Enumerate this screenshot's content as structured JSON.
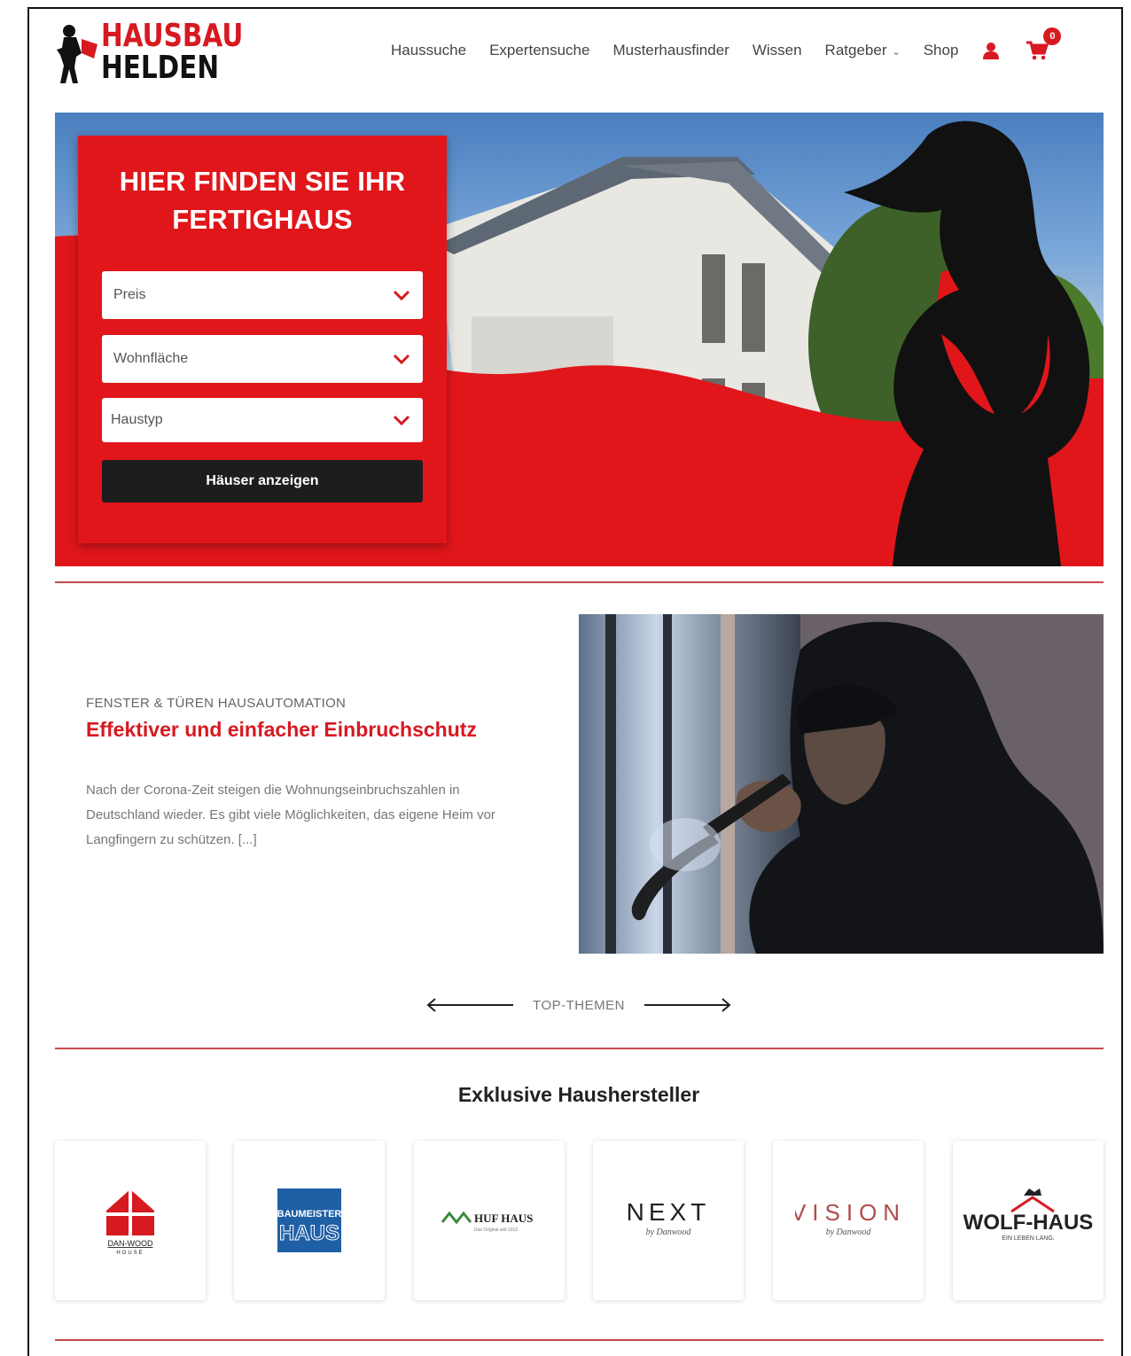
{
  "brand": {
    "line1": "HAUSBAU",
    "line2": "HELDEN"
  },
  "nav": {
    "items": [
      "Haussuche",
      "Expertensuche",
      "Musterhausfinder",
      "Wissen",
      "Ratgeber",
      "Shop"
    ],
    "cart_count": "0"
  },
  "hero": {
    "title_line1": "HIER FINDEN SIE IHR",
    "title_line2": "FERTIGHAUS",
    "selects": [
      {
        "placeholder": "Preis"
      },
      {
        "placeholder": "Wohnfläche"
      },
      {
        "placeholder": "Haustyp"
      }
    ],
    "button_label": "Häuser anzeigen"
  },
  "article": {
    "category": "FENSTER & TÜREN HAUSAUTOMATION",
    "title": "Effektiver und einfacher Einbruchschutz",
    "excerpt_line1": "Nach der Corona-Zeit steigen die Wohnungseinbruchszahlen in",
    "excerpt_line2": "Deutschland wieder. Es gibt viele Möglichkeiten, das eigene Heim vor",
    "excerpt_line3": "Langfingern zu schützen. [...]"
  },
  "top_themes": {
    "label": "TOP-THEMEN"
  },
  "manufacturers": {
    "title": "Exklusive Haushersteller",
    "items": [
      {
        "name": "DAN-WOOD",
        "sub": "HOUSE"
      },
      {
        "name": "BAUMEISTER",
        "sub": "HAUS"
      },
      {
        "name": "HUF HAUS",
        "sub": "Das Original seit 1912"
      },
      {
        "name": "NEXT",
        "sub": "by Danwood"
      },
      {
        "name": "VISION",
        "sub": "by Danwood"
      },
      {
        "name": "WOLF-HAUS",
        "sub": "EIN LEBEN LANG."
      }
    ]
  },
  "colors": {
    "brand_red": "#d71920",
    "dark": "#1d1d1d"
  }
}
